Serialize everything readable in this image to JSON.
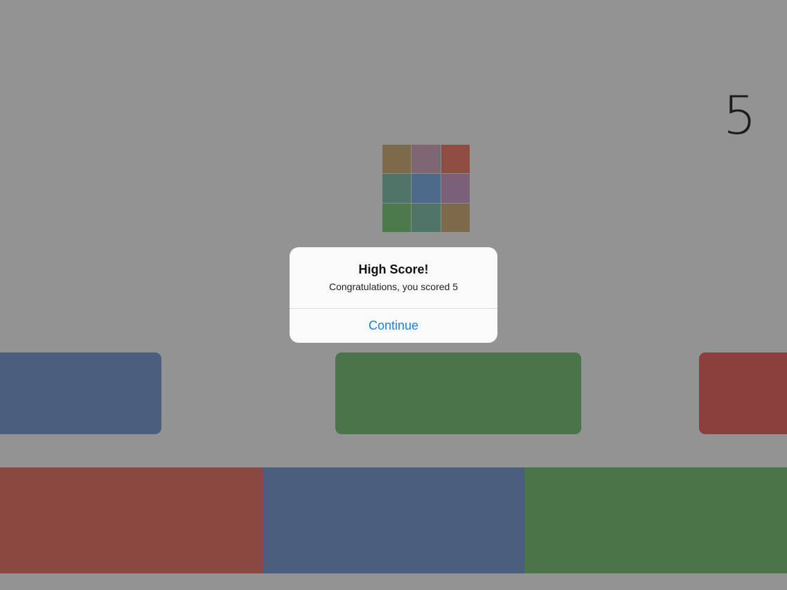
{
  "hud": {
    "score": "5"
  },
  "player_cube": {
    "cells": [
      {
        "color": "#7c6a4a"
      },
      {
        "color": "#7e6673"
      },
      {
        "color": "#8f4c43"
      },
      {
        "color": "#4f7468"
      },
      {
        "color": "#4c6a8a"
      },
      {
        "color": "#7a6177"
      },
      {
        "color": "#4d7a4d"
      },
      {
        "color": "#4f7468"
      },
      {
        "color": "#7c6a4a"
      }
    ]
  },
  "platforms": [
    {
      "color": "#4a5f7e",
      "name": "blue"
    },
    {
      "color": "#4a7449",
      "name": "green"
    },
    {
      "color": "#8c403d",
      "name": "red"
    }
  ],
  "floor": [
    {
      "color": "#8b4841",
      "name": "red"
    },
    {
      "color": "#495f7d",
      "name": "blue"
    },
    {
      "color": "#4a7549",
      "name": "green"
    }
  ],
  "alert": {
    "title": "High Score!",
    "message": "Congratulations, you scored 5",
    "button": "Continue"
  }
}
